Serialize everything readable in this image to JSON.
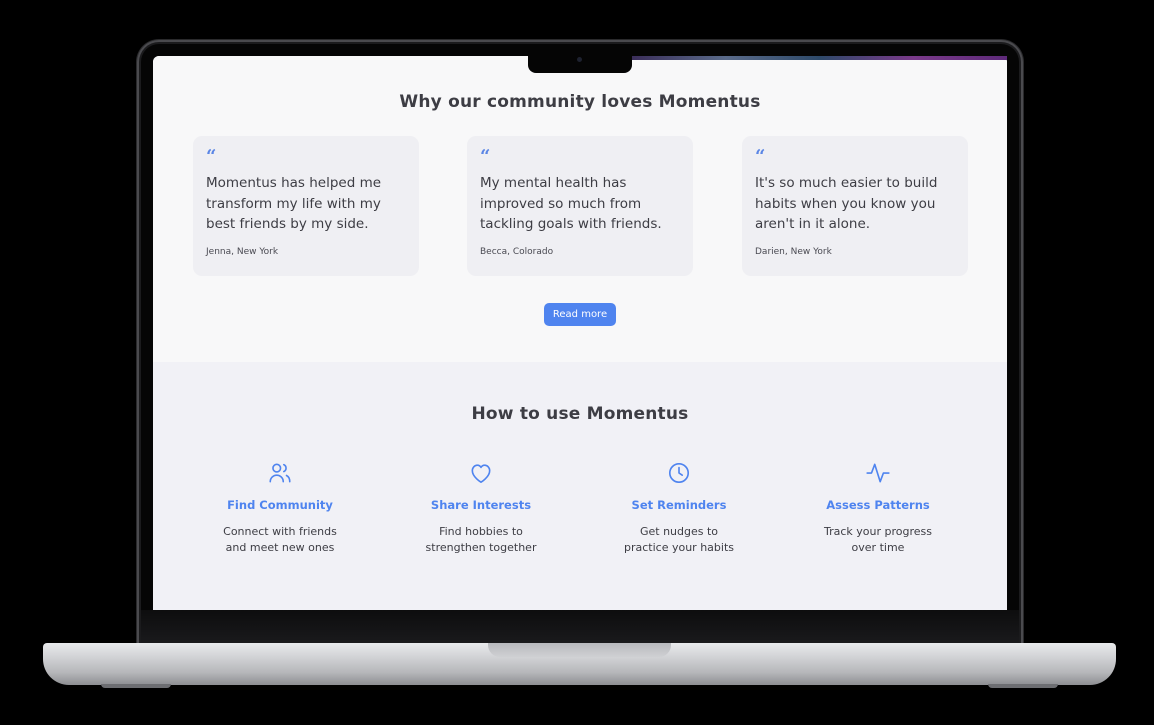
{
  "testimonials": {
    "title": "Why our community loves Momentus",
    "quote_glyph": "“",
    "cards": [
      {
        "text": "Momentus has helped me transform my life with my best friends by my side.",
        "author": "Jenna, New York"
      },
      {
        "text": "My mental health has improved so much from tackling goals with friends.",
        "author": "Becca, Colorado"
      },
      {
        "text": "It's so much easier to build habits when you know you aren't in it alone.",
        "author": "Darien, New York"
      }
    ],
    "read_more_label": "Read more"
  },
  "howto": {
    "title": "How to use Momentus",
    "features": [
      {
        "icon": "users-icon",
        "title": "Find Community",
        "desc_line1": "Connect with friends",
        "desc_line2": "and meet new ones"
      },
      {
        "icon": "heart-icon",
        "title": "Share Interests",
        "desc_line1": "Find hobbies to",
        "desc_line2": "strengthen together"
      },
      {
        "icon": "clock-icon",
        "title": "Set Reminders",
        "desc_line1": "Get nudges to",
        "desc_line2": "practice your habits"
      },
      {
        "icon": "activity-icon",
        "title": "Assess Patterns",
        "desc_line1": "Track your progress",
        "desc_line2": "over time"
      }
    ]
  },
  "colors": {
    "accent": "#4f84ef",
    "text": "#3d3d44",
    "card_bg": "#efeff3",
    "section_bg": "#f1f1f6"
  }
}
